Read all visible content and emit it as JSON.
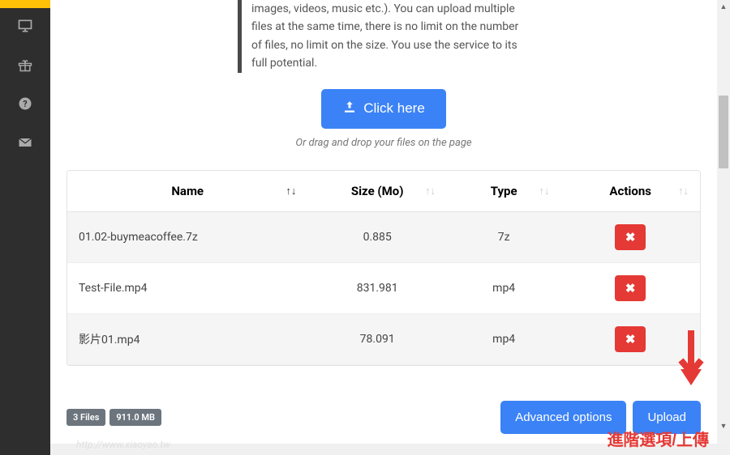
{
  "info_text": "images, videos, music etc.). You can upload multiple files at the same time, there is no limit on the number of files, no limit on the size. You use the service to its full potential.",
  "upload": {
    "button_label": "Click here",
    "hint": "Or drag and drop your files on the page"
  },
  "table": {
    "headers": {
      "name": "Name",
      "size": "Size (Mo)",
      "type": "Type",
      "actions": "Actions"
    },
    "rows": [
      {
        "name": "01.02-buymeacoffee.7z",
        "size": "0.885",
        "type": "7z"
      },
      {
        "name": "Test-File.mp4",
        "size": "831.981",
        "type": "mp4"
      },
      {
        "name": "影片01.mp4",
        "size": "78.091",
        "type": "mp4"
      }
    ],
    "delete_symbol": "✖"
  },
  "footer": {
    "files_badge": "3 Files",
    "size_badge": "911.0 MB",
    "advanced_label": "Advanced options",
    "upload_label": "Upload"
  },
  "annotation": "進階選項/上傳",
  "watermark": "http://www.xiaoyao.tw",
  "sort_glyph_active": "↑",
  "sort_glyph": "↑↓"
}
